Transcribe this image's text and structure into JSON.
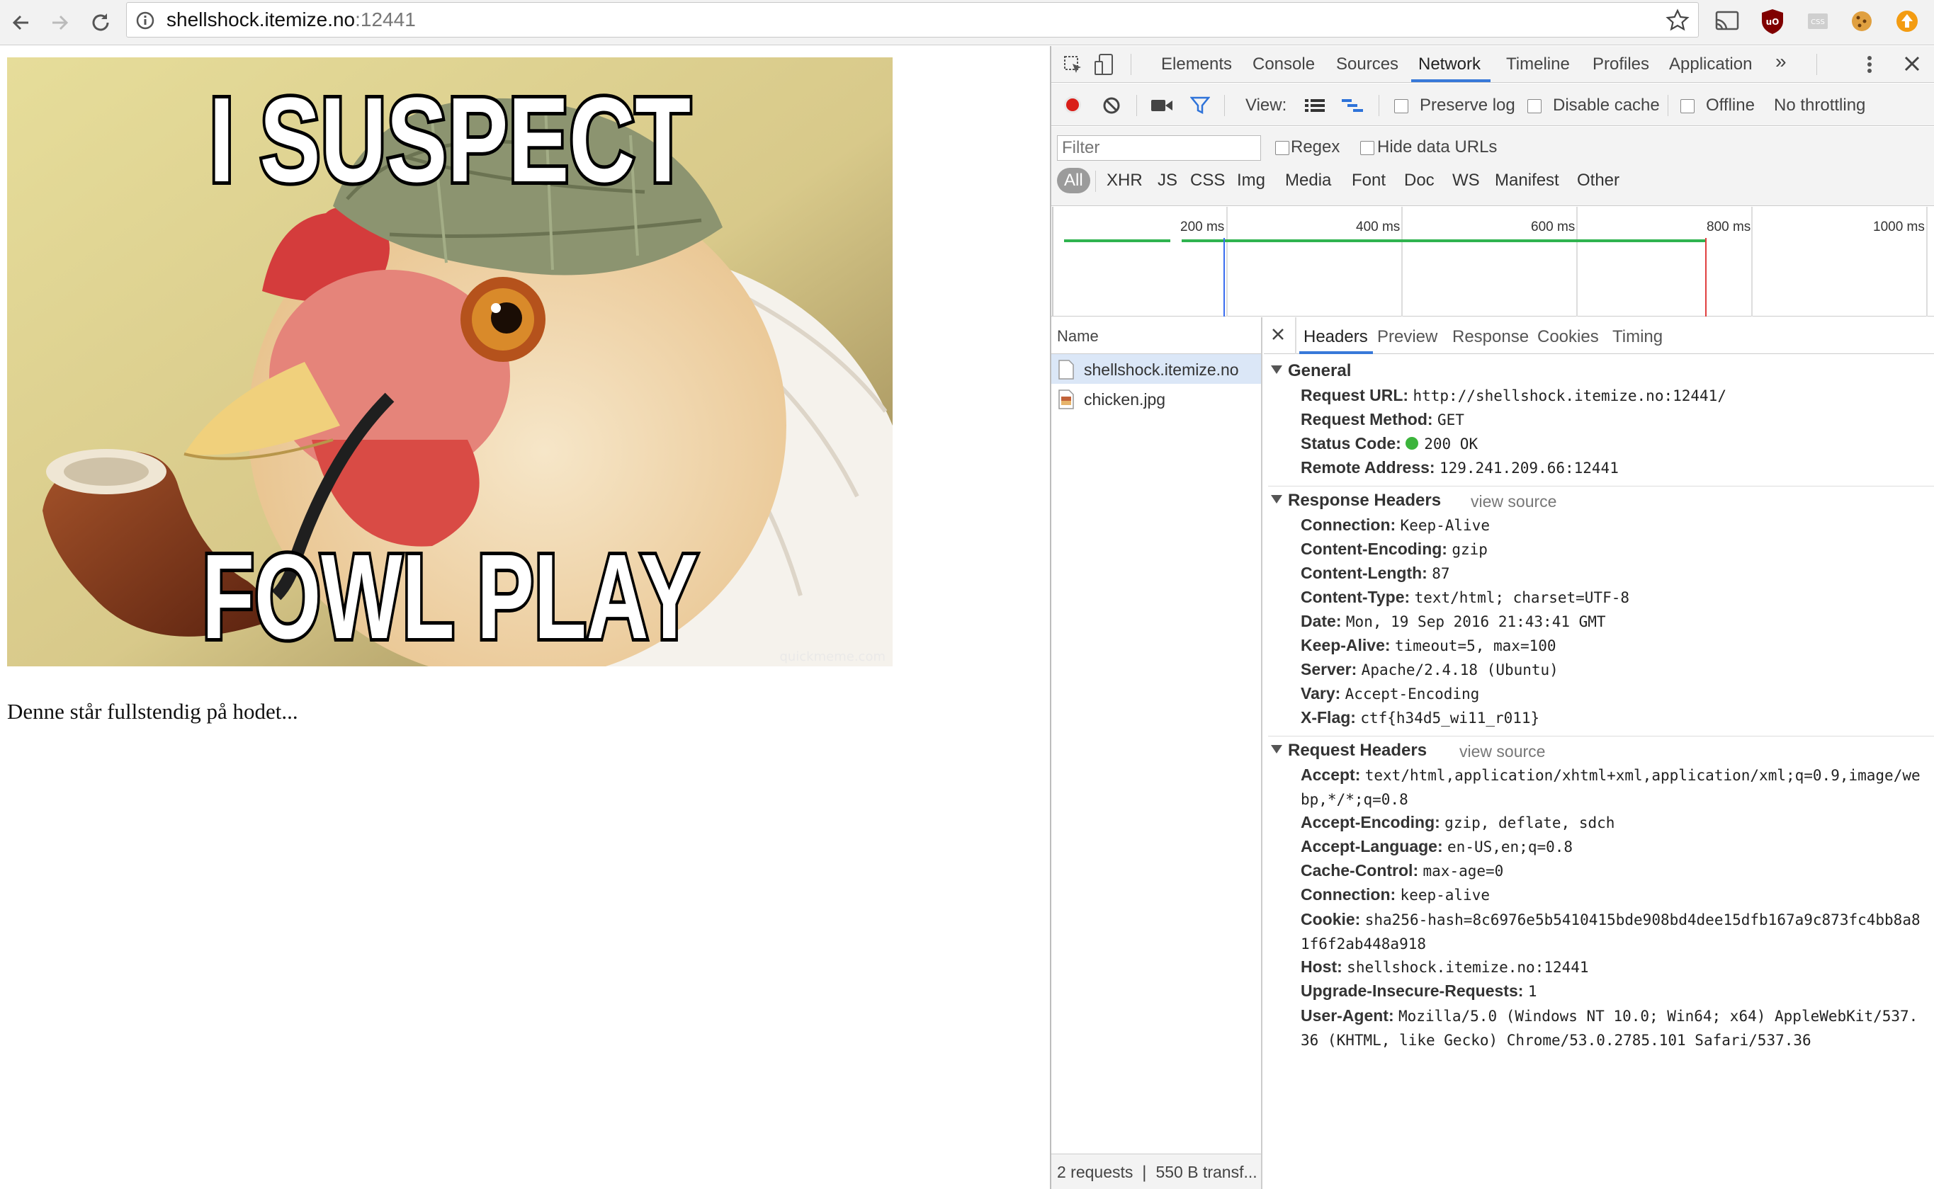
{
  "browser": {
    "url_host": "shellshock.itemize.no",
    "url_port": ":12441",
    "colors": {
      "toolbar_bg": "#f2f2f2",
      "accent": "#3879d9"
    }
  },
  "page": {
    "meme_top_text": "I SUSPECT",
    "meme_bottom_text": "FOWL PLAY",
    "meme_watermark": "quickmeme.com",
    "caption": "Denne står fullstendig på hodet..."
  },
  "devtools": {
    "tabs": [
      "Elements",
      "Console",
      "Sources",
      "Network",
      "Timeline",
      "Profiles",
      "Application"
    ],
    "more_tabs_icon": "»",
    "active_tab": "Network",
    "toolbar": {
      "view_label": "View:",
      "preserve_log": "Preserve log",
      "disable_cache": "Disable cache",
      "offline": "Offline",
      "throttling": "No throttling"
    },
    "filter": {
      "placeholder": "Filter",
      "regex": "Regex",
      "hide_data_urls": "Hide data URLs",
      "types": [
        "All",
        "XHR",
        "JS",
        "CSS",
        "Img",
        "Media",
        "Font",
        "Doc",
        "WS",
        "Manifest",
        "Other"
      ]
    },
    "timeline_ticks": [
      "200 ms",
      "400 ms",
      "600 ms",
      "800 ms",
      "1000 ms"
    ],
    "list": {
      "header": "Name",
      "requests": [
        {
          "name": "shellshock.itemize.no",
          "icon": "document-icon"
        },
        {
          "name": "chicken.jpg",
          "icon": "image-icon"
        }
      ],
      "status": "2 requests  ❘  550 B transf..."
    },
    "detail": {
      "tabs": [
        "Headers",
        "Preview",
        "Response",
        "Cookies",
        "Timing"
      ],
      "active_tab": "Headers",
      "general": {
        "title": "General",
        "request_url_key": "Request URL:",
        "request_url": "http://shellshock.itemize.no:12441/",
        "method_key": "Request Method:",
        "method": "GET",
        "status_key": "Status Code:",
        "status": "200 OK",
        "status_color": "#3cb43c",
        "remote_key": "Remote Address:",
        "remote": "129.241.209.66:12441"
      },
      "response_headers": {
        "title": "Response Headers",
        "view_source": "view source",
        "rows": [
          {
            "key": "Connection:",
            "value": "Keep-Alive"
          },
          {
            "key": "Content-Encoding:",
            "value": "gzip"
          },
          {
            "key": "Content-Length:",
            "value": "87"
          },
          {
            "key": "Content-Type:",
            "value": "text/html; charset=UTF-8"
          },
          {
            "key": "Date:",
            "value": "Mon, 19 Sep 2016 21:43:41 GMT"
          },
          {
            "key": "Keep-Alive:",
            "value": "timeout=5, max=100"
          },
          {
            "key": "Server:",
            "value": "Apache/2.4.18 (Ubuntu)"
          },
          {
            "key": "Vary:",
            "value": "Accept-Encoding"
          },
          {
            "key": "X-Flag:",
            "value": "ctf{h34d5_wi11_r011}"
          }
        ]
      },
      "request_headers": {
        "title": "Request Headers",
        "view_source": "view source",
        "accept_key": "Accept:",
        "accept": "text/html,application/xhtml+xml,application/xml;q=0.9,image/webp,*/*;q=0.8",
        "accept_encoding_key": "Accept-Encoding:",
        "accept_encoding": "gzip, deflate, sdch",
        "accept_language_key": "Accept-Language:",
        "accept_language": "en-US,en;q=0.8",
        "cache_control_key": "Cache-Control:",
        "cache_control": "max-age=0",
        "connection_key": "Connection:",
        "connection": "keep-alive",
        "cookie_key": "Cookie:",
        "cookie": "sha256-hash=8c6976e5b5410415bde908bd4dee15dfb167a9c873fc4bb8a81f6f2ab448a918",
        "host_key": "Host:",
        "host": "shellshock.itemize.no:12441",
        "upgrade_key": "Upgrade-Insecure-Requests:",
        "upgrade": "1",
        "user_agent_key": "User-Agent:",
        "user_agent": "Mozilla/5.0 (Windows NT 10.0; Win64; x64) AppleWebKit/537.36 (KHTML, like Gecko) Chrome/53.0.2785.101 Safari/537.36"
      }
    }
  }
}
